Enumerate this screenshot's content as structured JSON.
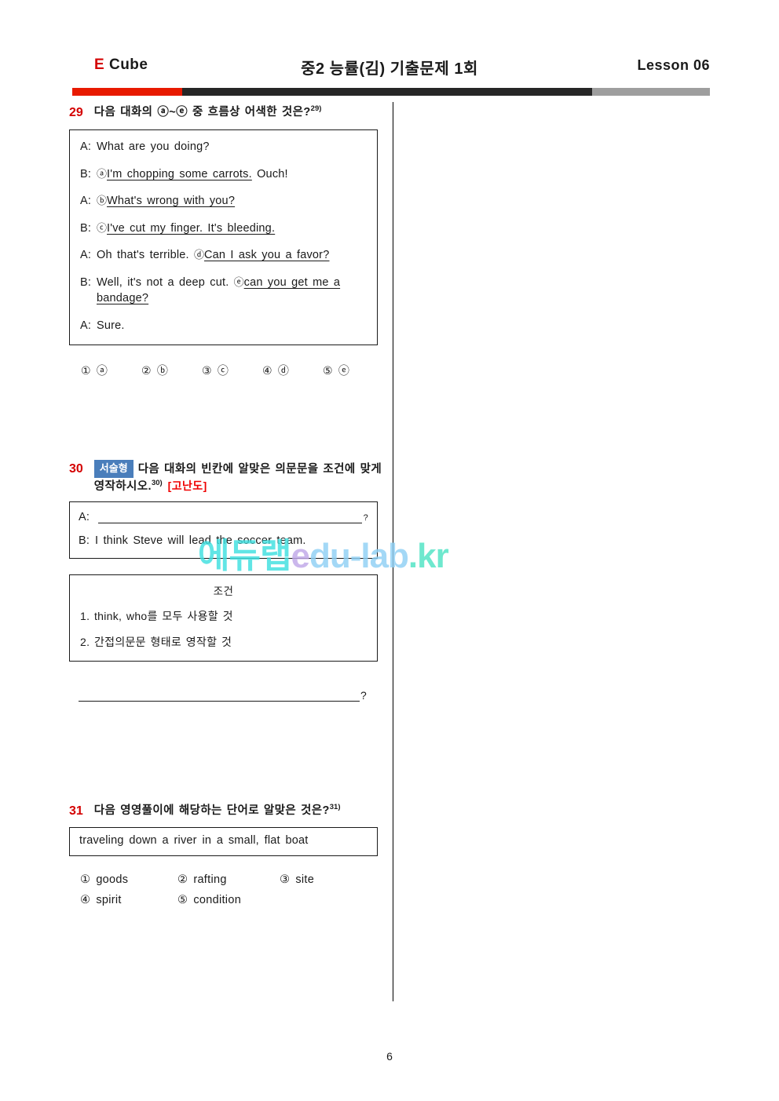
{
  "header": {
    "brand_letter": "E",
    "brand_word": "Cube",
    "title": "중2 능률(김) 기출문제 1회",
    "lesson": "Lesson 06"
  },
  "watermark": {
    "part1": "에듀랩",
    "part2": "e",
    "part3": "du-lab",
    "part4": ".kr"
  },
  "footer": {
    "page_number": "6"
  },
  "colors": {
    "question_number": "#d40000",
    "brand_e": "#d40000",
    "badge_bg": "#4a7ebb",
    "hard_tag": "#ef0000",
    "bar_red": "#e81a00",
    "bar_dark": "#262626",
    "bar_gray": "#9e9e9e"
  },
  "questions": [
    {
      "number": "29",
      "prompt": "다음 대화의 ⓐ~ⓔ 중 흐름상 어색한 것은?",
      "footnote": "29)",
      "dialog": [
        {
          "speaker": "A:",
          "plain_before": "What are you doing?",
          "marker": "",
          "underlined": "",
          "plain_after": ""
        },
        {
          "speaker": "B:",
          "plain_before": "",
          "marker": "ⓐ",
          "underlined": "I'm chopping some carrots.",
          "plain_after": " Ouch!"
        },
        {
          "speaker": "A:",
          "plain_before": "",
          "marker": "ⓑ",
          "underlined": "What's wrong with you?",
          "plain_after": ""
        },
        {
          "speaker": "B:",
          "plain_before": "",
          "marker": "ⓒ",
          "underlined": "I've cut my finger. It's bleeding.",
          "plain_after": ""
        },
        {
          "speaker": "A:",
          "plain_before": "Oh that's terrible. ",
          "marker": "ⓓ",
          "underlined": "Can I ask you a favor?",
          "plain_after": ""
        },
        {
          "speaker": "B:",
          "plain_before": "Well, it's not a deep cut. ",
          "marker": "ⓔ",
          "underlined": "can you get me a bandage?",
          "plain_after": ""
        },
        {
          "speaker": "A:",
          "plain_before": "Sure.",
          "marker": "",
          "underlined": "",
          "plain_after": ""
        }
      ],
      "choices": [
        {
          "num": "①",
          "label": "ⓐ"
        },
        {
          "num": "②",
          "label": "ⓑ"
        },
        {
          "num": "③",
          "label": "ⓒ"
        },
        {
          "num": "④",
          "label": "ⓓ"
        },
        {
          "num": "⑤",
          "label": "ⓔ"
        }
      ]
    },
    {
      "number": "30",
      "badge": "서술형",
      "prompt": "다음 대화의 빈칸에 알맞은 의문문을 조건에 맞게 영작하시오.",
      "footnote": "30)",
      "difficulty_tag": "[고난도]",
      "fill_in": {
        "line_a_speaker": "A:",
        "line_a_qmark": "?",
        "line_b_speaker": "B:",
        "line_b_text": "I think Steve will lead the soccer team."
      },
      "conditions": {
        "title": "조건",
        "items": [
          "1. think, who를 모두 사용할 것",
          "2. 간접의문문 형태로 영작할 것"
        ]
      },
      "answer_qmark": "?"
    },
    {
      "number": "31",
      "prompt": "다음 영영풀이에 해당하는 단어로 알맞은 것은?",
      "footnote": "31)",
      "definition": "traveling down a river in a small, flat boat",
      "choices": [
        {
          "num": "①",
          "label": "goods"
        },
        {
          "num": "②",
          "label": "rafting"
        },
        {
          "num": "③",
          "label": "site"
        },
        {
          "num": "④",
          "label": "spirit"
        },
        {
          "num": "⑤",
          "label": "condition"
        }
      ]
    }
  ]
}
